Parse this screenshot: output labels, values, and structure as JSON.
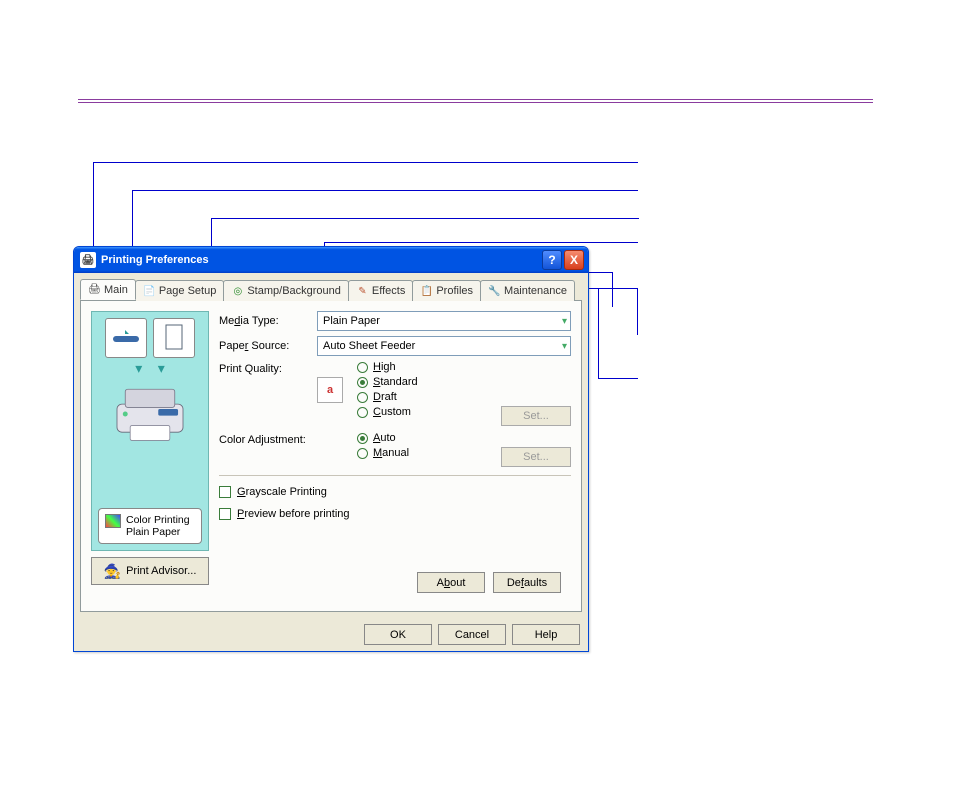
{
  "window": {
    "title": "Printing Preferences"
  },
  "titlebar": {
    "help": "?",
    "close": "X"
  },
  "tabs": [
    {
      "label": "Main"
    },
    {
      "label": "Page Setup"
    },
    {
      "label": "Stamp/Background"
    },
    {
      "label": "Effects"
    },
    {
      "label": "Profiles"
    },
    {
      "label": "Maintenance"
    }
  ],
  "form": {
    "mediaType": {
      "label": "Media Type:",
      "value": "Plain Paper",
      "underline": "d"
    },
    "paperSource": {
      "label": "Paper Source:",
      "value": "Auto Sheet Feeder",
      "underline": "r"
    },
    "printQuality": {
      "label": "Print Quality:",
      "options": {
        "high": "High",
        "standard": "Standard",
        "draft": "Draft",
        "custom": "Custom"
      },
      "underline": {
        "high": "H",
        "standard": "S",
        "draft": "D",
        "custom": "C"
      },
      "setBtn": "Set..."
    },
    "colorAdjustment": {
      "label": "Color Adjustment:",
      "options": {
        "auto": "Auto",
        "manual": "Manual"
      },
      "underline": {
        "auto": "A",
        "manual": "M"
      },
      "setBtn": "Set..."
    },
    "grayscale": {
      "label": "Grayscale Printing",
      "underline": "G"
    },
    "preview": {
      "label": "Preview before printing",
      "underline": "P"
    }
  },
  "infoBox": {
    "line1": "Color Printing",
    "line2": "Plain Paper"
  },
  "advisor": {
    "label": "Print Advisor..."
  },
  "panelButtons": {
    "about": "About",
    "defaults": "Defaults"
  },
  "dialogButtons": {
    "ok": "OK",
    "cancel": "Cancel",
    "help": "Help"
  }
}
